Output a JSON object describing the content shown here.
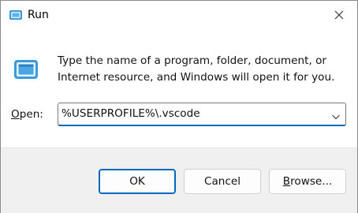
{
  "window": {
    "title": "Run",
    "icon": "run-dialog-icon",
    "close_icon": "close-icon"
  },
  "body": {
    "description_line1": "Type the name of a program, folder, document, or",
    "description_line2": "Internet resource, and Windows will open it for you.",
    "open_label_accel": "O",
    "open_label_rest": "pen:",
    "open_value": "%USERPROFILE%\\.vscode",
    "dropdown_icon": "chevron-down-icon"
  },
  "buttons": {
    "ok": "OK",
    "cancel": "Cancel",
    "browse_accel": "B",
    "browse_rest": "rowse..."
  },
  "colors": {
    "accent": "#0067c0",
    "footer_bg": "#f0f0f0",
    "icon_blue": "#3b9ad9"
  }
}
